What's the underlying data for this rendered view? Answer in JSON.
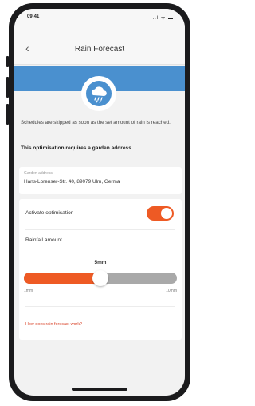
{
  "status_bar": {
    "time": "09:41",
    "icons": "..l ᯤ ▬"
  },
  "header": {
    "title": "Rain Forecast",
    "back_icon": "chevron-left-icon"
  },
  "banner": {
    "icon": "rain-cloud-icon",
    "color": "#4a90cf"
  },
  "description": {
    "text": "Schedules are skipped as soon as the set amount of rain is reached.",
    "notice": "This optimisation requires a garden address."
  },
  "address": {
    "label": "Garden address",
    "value": "Hans-Lorenser-Str. 40, 89079 Ulm, Germa"
  },
  "optimisation": {
    "label": "Activate optimisation",
    "enabled": true
  },
  "rainfall": {
    "label": "Rainfall amount",
    "value_label": "5mm",
    "min_label": "1mm",
    "max_label": "10mm",
    "fraction": 0.5
  },
  "help_link": "How does rain forecast work?",
  "colors": {
    "accent": "#ee5a24",
    "track": "#a9a9a9",
    "banner": "#4a90cf"
  }
}
